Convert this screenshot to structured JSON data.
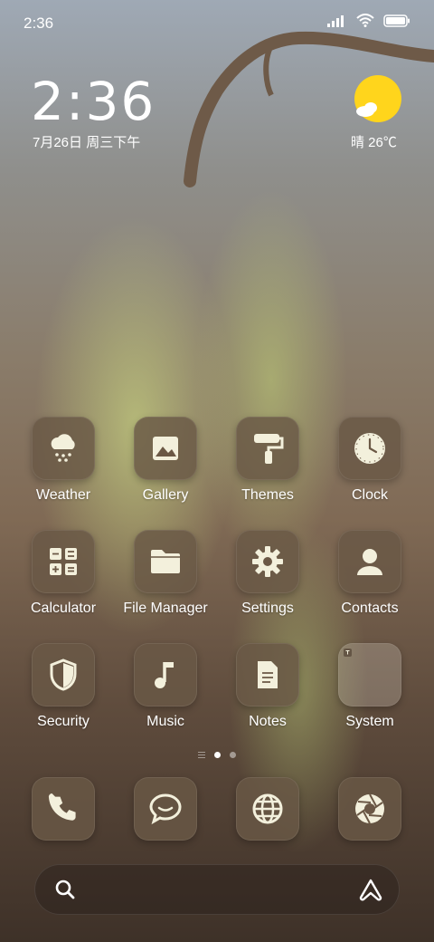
{
  "status_bar": {
    "time": "2:36",
    "icons": [
      "signal-icon",
      "wifi-icon",
      "battery-icon"
    ]
  },
  "clock_widget": {
    "time": "2:36",
    "date": "7月26日 周三下午"
  },
  "weather_widget": {
    "text": "晴 26℃",
    "icon": "sunny-partly-cloudy-icon"
  },
  "apps": [
    {
      "label": "Weather",
      "icon": "weather-cloud-icon"
    },
    {
      "label": "Gallery",
      "icon": "gallery-image-icon"
    },
    {
      "label": "Themes",
      "icon": "paint-roller-icon"
    },
    {
      "label": "Clock",
      "icon": "clock-icon"
    },
    {
      "label": "Calculator",
      "icon": "calculator-icon"
    },
    {
      "label": "File Manager",
      "icon": "folder-icon"
    },
    {
      "label": "Settings",
      "icon": "gear-icon"
    },
    {
      "label": "Contacts",
      "icon": "person-icon"
    },
    {
      "label": "Security",
      "icon": "shield-icon"
    },
    {
      "label": "Music",
      "icon": "music-note-icon"
    },
    {
      "label": "Notes",
      "icon": "note-icon"
    },
    {
      "label": "System",
      "icon": "folder-system-icon"
    }
  ],
  "page_indicator": {
    "pages": 2,
    "active": 1
  },
  "dock": [
    {
      "name": "phone",
      "icon": "phone-icon"
    },
    {
      "name": "messages",
      "icon": "message-icon"
    },
    {
      "name": "browser",
      "icon": "globe-icon"
    },
    {
      "name": "camera",
      "icon": "aperture-icon"
    }
  ],
  "search_bar": {
    "left_icon": "search-icon",
    "right_icon": "assistant-icon"
  },
  "colors": {
    "icon_tile": "#695846",
    "sun": "#ffd51c",
    "glyph": "#f3f0dc"
  }
}
